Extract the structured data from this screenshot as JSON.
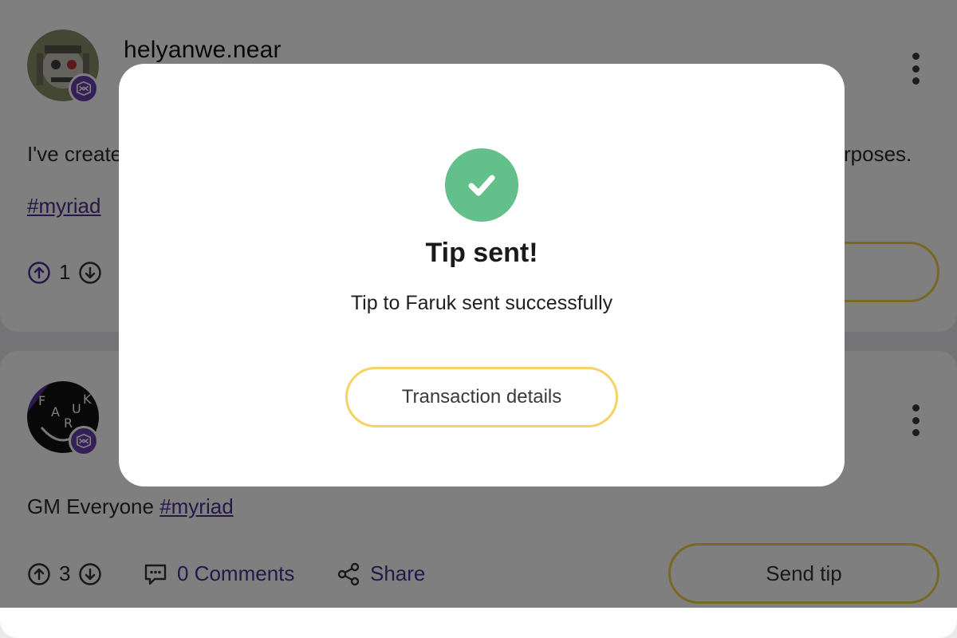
{
  "feed": {
    "post1": {
      "username": "helyanwe.near",
      "text_left": "I've create",
      "text_right": "rposes.",
      "hashtag": "#myriad",
      "upvotes": "1"
    },
    "post2": {
      "avatar_letters": [
        "F",
        "A",
        "R",
        "U",
        "K"
      ],
      "text": "GM Everyone",
      "hashtag": "#myriad",
      "upvotes": "3",
      "comments_label": "0 Comments",
      "share_label": "Share",
      "send_tip_label": "Send tip"
    }
  },
  "modal": {
    "title": "Tip sent!",
    "message": "Tip to Faruk sent successfully",
    "button_label": "Transaction details"
  },
  "colors": {
    "brand_purple": "#6b3fb0",
    "link_purple": "#4a2f8e",
    "success_green": "#63c08a",
    "button_outline": "#f2cf4a"
  },
  "icons": {
    "upvote": "arrow-up-circle-icon",
    "downvote": "arrow-down-circle-icon",
    "comments": "comment-icon",
    "share": "share-icon",
    "menu": "kebab-menu-icon",
    "success": "check-icon",
    "badge": "myriad-logo-icon"
  }
}
